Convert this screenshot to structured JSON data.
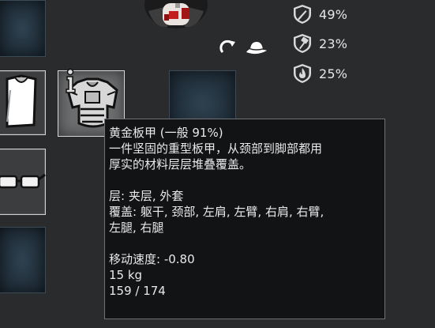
{
  "stats": {
    "sharp": "49%",
    "blunt": "23%",
    "heat": "25%"
  },
  "tooltip": {
    "title": "黄金板甲 (一般 91%)",
    "desc_line1": "一件坚固的重型板甲，从颈部到脚部都用",
    "desc_line2": "厚实的材料层层堆叠覆盖。",
    "layers": "层: 夹层, 外套",
    "covers_line1": "覆盖: 躯干, 颈部, 左肩, 左臂, 右肩, 右臂,",
    "covers_line2": "左腿, 右腿",
    "move_speed": "移动速度: -0.80",
    "mass": "15 kg",
    "hp": "159 / 174"
  },
  "icons": {
    "sharp": "sharp-armor-shield-icon",
    "blunt": "blunt-armor-shield-icon",
    "heat": "heat-armor-shield-icon",
    "info": "info-icon",
    "rotate": "rotate-icon",
    "hat": "hat-icon"
  },
  "colors": {
    "panel_bg": "#2a2b2c",
    "tooltip_bg": "#111315",
    "tooltip_border": "#6e7276",
    "slot_empty": "#2a3a47",
    "text": "#e9e9e9"
  }
}
